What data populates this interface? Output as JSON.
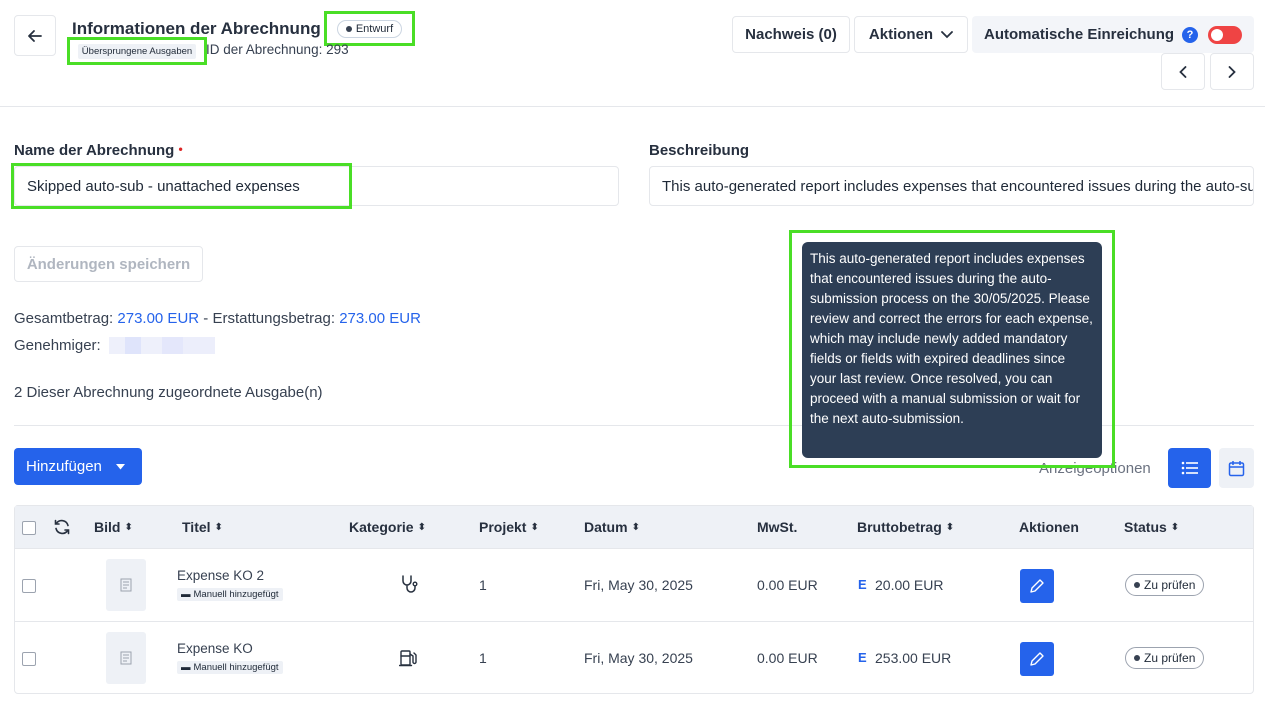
{
  "header": {
    "title": "Informationen der Abrechnung",
    "status_badge": "Entwurf",
    "tag": "Übersprungene Ausgaben",
    "report_id": "ID der Abrechnung: 293",
    "proof_button": "Nachweis (0)",
    "actions_button": "Aktionen",
    "auto_submit_label": "Automatische Einreichung",
    "help_icon": "?"
  },
  "form": {
    "name_label": "Name der Abrechnung",
    "name_required": "•",
    "name_value": "Skipped auto-sub - unattached expenses",
    "description_label": "Beschreibung",
    "description_value": "This auto-generated report includes expenses that encountered issues during the auto-submission process on the 30/05/2025.",
    "save_button": "Änderungen speichern"
  },
  "summary": {
    "total_label": "Gesamtbetrag:",
    "total_value": "273.00 EUR",
    "separator": "-",
    "refund_label": "Erstattungsbetrag:",
    "refund_value": "273.00 EUR",
    "approver_label": "Genehmiger:",
    "expense_count": "2 Dieser Abrechnung zugeordnete Ausgabe(n)"
  },
  "toolbar": {
    "add_button": "Hinzufügen",
    "display_options": "Anzeigeoptionen"
  },
  "table": {
    "headers": {
      "image": "Bild",
      "title": "Titel",
      "category": "Kategorie",
      "project": "Projekt",
      "date": "Datum",
      "vat": "MwSt.",
      "gross": "Bruttobetrag",
      "actions": "Aktionen",
      "status": "Status"
    },
    "rows": [
      {
        "title": "Expense KO 2",
        "tag": "Manuell hinzugefügt",
        "category_icon": "stethoscope-icon",
        "project": "1",
        "date": "Fri, May 30, 2025",
        "vat": "0.00 EUR",
        "card": "E",
        "gross": "20.00 EUR",
        "status": "Zu prüfen"
      },
      {
        "title": "Expense KO",
        "tag": "Manuell hinzugefügt",
        "category_icon": "fuel-icon",
        "project": "1",
        "date": "Fri, May 30, 2025",
        "vat": "0.00 EUR",
        "card": "E",
        "gross": "253.00 EUR",
        "status": "Zu prüfen"
      }
    ]
  },
  "tooltip": {
    "text": "This auto-generated report includes expenses that encountered issues during the auto-submission process on the 30/05/2025. Please review and correct the errors for each expense, which may include newly added mandatory fields or fields with expired deadlines since your last review. Once resolved, you can proceed with a manual submission or wait for the next auto-submission."
  },
  "colors": {
    "accent": "#2563eb",
    "toggle_off": "#ef4444",
    "tooltip_bg": "#2d3e55",
    "highlight": "#4ade26"
  }
}
